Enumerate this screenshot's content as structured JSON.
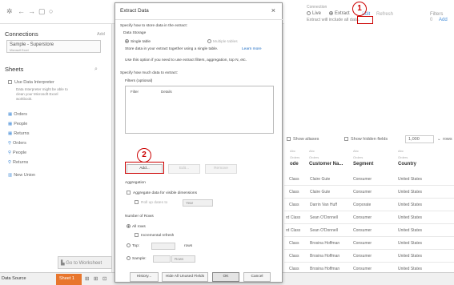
{
  "topbar": {
    "icons": [
      "tableau-logo-icon",
      "back-icon",
      "forward-icon",
      "save-icon",
      "refresh-icon"
    ]
  },
  "sidebar": {
    "connections_title": "Connections",
    "connections_add": "Add",
    "connection_name": "Sample - Superstore",
    "connection_sub": "Microsoft Excel",
    "sheets_title": "Sheets",
    "interpreter_label": "Use Data Interpreter",
    "interpreter_desc": [
      "Data Interpreter might be able to",
      "clean your Microsoft Excel",
      "workbook."
    ],
    "sheets": [
      "Orders",
      "People",
      "Returns",
      "Orders",
      "People",
      "Returns"
    ],
    "new_union": "New Union"
  },
  "right": {
    "connection_label": "Connection",
    "live_label": "Live",
    "extract_label": "Extract",
    "edit_label": "Edit",
    "refresh_label": "Refresh",
    "extract_note": "Extract will include all data.",
    "filters_label": "Filters",
    "filters_value": "0",
    "filters_add": "Add",
    "show_aliases": "Show aliases",
    "show_hidden": "Show hidden fields",
    "rows_value": "1,000",
    "rows_suffix": "rows",
    "columns": [
      {
        "type": "Abc",
        "source": "Orders",
        "name": "ode"
      },
      {
        "type": "Abc",
        "source": "Orders",
        "name": "Customer Na..."
      },
      {
        "type": "Abc",
        "source": "Orders",
        "name": "Segment"
      },
      {
        "type": "Abc",
        "source": "Orders",
        "name": "Country"
      }
    ],
    "rows": [
      [
        "Class",
        "Claire Gute",
        "Consumer",
        "United States"
      ],
      [
        "Class",
        "Claire Gute",
        "Consumer",
        "United States"
      ],
      [
        "Class",
        "Darrin Van Huff",
        "Corporate",
        "United States"
      ],
      [
        "rd Class",
        "Sean O'Donnell",
        "Consumer",
        "United States"
      ],
      [
        "rd Class",
        "Sean O'Donnell",
        "Consumer",
        "United States"
      ],
      [
        "Class",
        "Brosina Hoffman",
        "Consumer",
        "United States"
      ],
      [
        "Class",
        "Brosina Hoffman",
        "Consumer",
        "United States"
      ],
      [
        "Class",
        "Brosina Hoffman",
        "Consumer",
        "United States"
      ]
    ]
  },
  "dialog": {
    "title": "Extract Data",
    "close": "×",
    "store_prompt": "Specify how to store data in the extract:",
    "data_storage": "Data Storage",
    "single_table": "Single table",
    "multiple_tables": "Multiple tables",
    "store_desc": "Store data in your extract together using a single table.",
    "learn_more": "Learn more",
    "use_option": "Use this option if you need to use extract filters, aggregation, top N, etc.",
    "how_much": "Specify how much data to extract:",
    "filters_optional": "Filters (optional)",
    "col_filter": "Filter",
    "col_details": "Details",
    "add_btn": "Add...",
    "edit_btn": "Edit...",
    "remove_btn": "Remove",
    "aggregation": "Aggregation",
    "aggregate_visible": "Aggregate data for visible dimensions",
    "roll_up": "Roll up dates to",
    "roll_up_value": "Year",
    "number_of_rows": "Number of Rows",
    "all_rows": "All rows",
    "incremental": "Incremental refresh",
    "top": "Top:",
    "top_unit": "rows",
    "sample": "Sample:",
    "sample_unit": "Rows",
    "history_btn": "History...",
    "hide_unused_btn": "Hide All Unused Fields",
    "ok_btn": "OK",
    "cancel_btn": "Cancel"
  },
  "annotations": {
    "marker1": "1",
    "marker2": "2"
  },
  "bottombar": {
    "data_source": "Data Source",
    "sheet_tab": "Sheet 1",
    "quick_worksheet": "Go to Worksheet"
  },
  "colors": {
    "accent_orange": "#e8762d",
    "annotation_red": "#cc0000",
    "link_blue": "#1a6bc4"
  }
}
